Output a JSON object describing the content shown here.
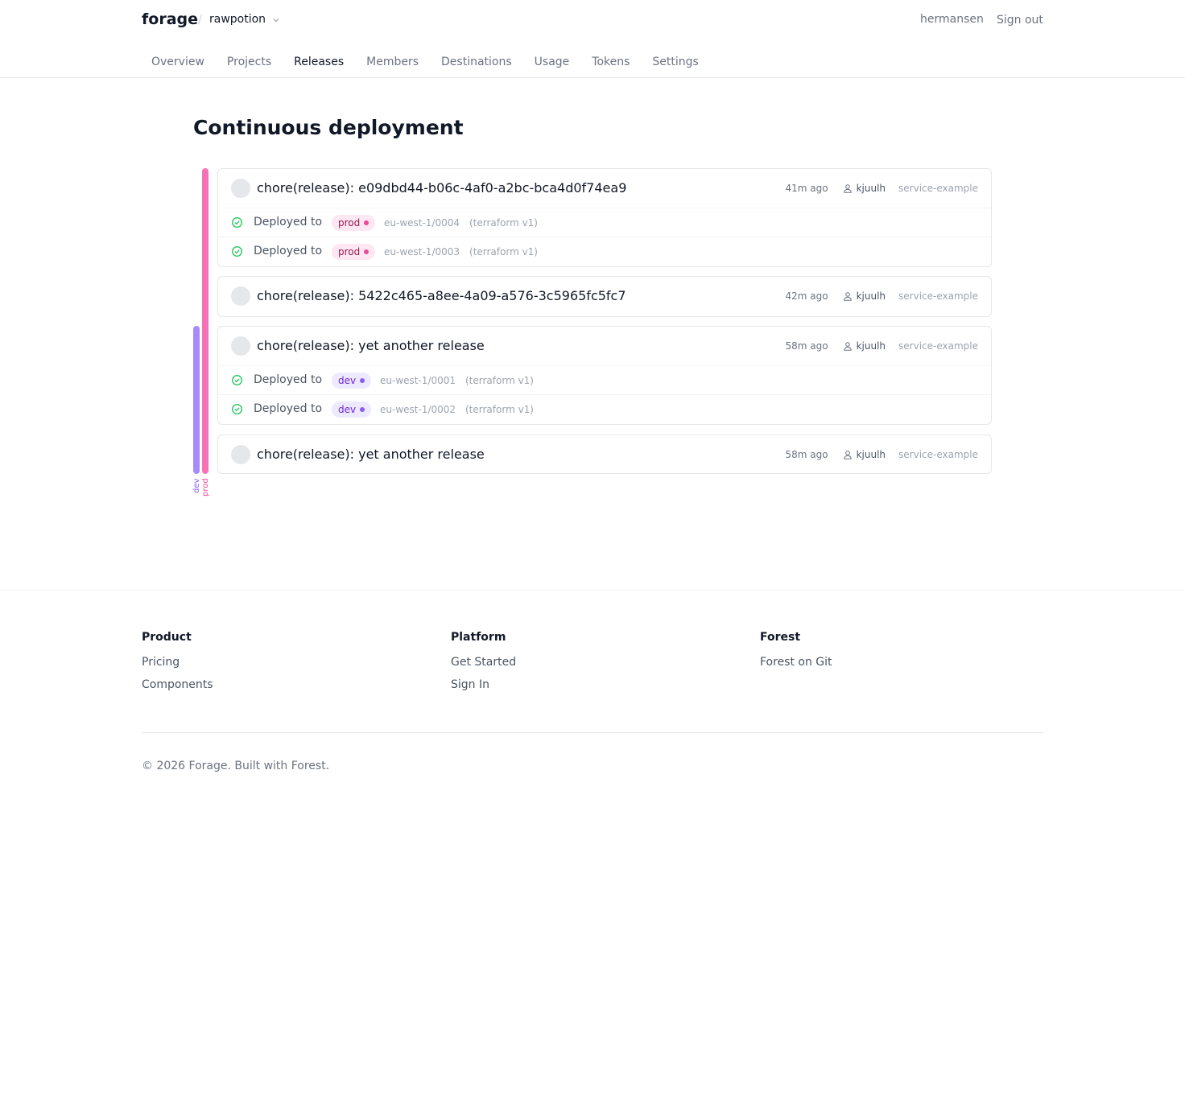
{
  "header": {
    "brand": "forage",
    "separator": "/",
    "organisation": "rawpotion",
    "username": "hermansen",
    "sign_out": "Sign out",
    "tabs": [
      {
        "label": "Overview",
        "active": false
      },
      {
        "label": "Projects",
        "active": false
      },
      {
        "label": "Releases",
        "active": true
      },
      {
        "label": "Members",
        "active": false
      },
      {
        "label": "Destinations",
        "active": false
      },
      {
        "label": "Usage",
        "active": false
      },
      {
        "label": "Tokens",
        "active": false
      },
      {
        "label": "Settings",
        "active": false
      }
    ]
  },
  "main": {
    "title": "Continuous deployment",
    "lanes": [
      {
        "name": "dev",
        "color": "#a78bfa"
      },
      {
        "name": "prod",
        "color": "#f472b6"
      }
    ],
    "releases": [
      {
        "title": "chore(release): e09dbd44-b06c-4af0-a2bc-bca4d0f74ea9",
        "time": "41m ago",
        "author": "kjuulh",
        "service": "service-example",
        "deployments": [
          {
            "label": "Deployed to",
            "env": "prod",
            "destination": "eu-west-1/0004",
            "kind": "(terraform v1)"
          },
          {
            "label": "Deployed to",
            "env": "prod",
            "destination": "eu-west-1/0003",
            "kind": "(terraform v1)"
          }
        ]
      },
      {
        "title": "chore(release): 5422c465-a8ee-4a09-a576-3c5965fc5fc7",
        "time": "42m ago",
        "author": "kjuulh",
        "service": "service-example",
        "deployments": []
      },
      {
        "title": "chore(release): yet another release",
        "time": "58m ago",
        "author": "kjuulh",
        "service": "service-example",
        "deployments": [
          {
            "label": "Deployed to",
            "env": "dev",
            "destination": "eu-west-1/0001",
            "kind": "(terraform v1)"
          },
          {
            "label": "Deployed to",
            "env": "dev",
            "destination": "eu-west-1/0002",
            "kind": "(terraform v1)"
          }
        ]
      },
      {
        "title": "chore(release): yet another release",
        "time": "58m ago",
        "author": "kjuulh",
        "service": "service-example",
        "deployments": []
      }
    ]
  },
  "footer": {
    "columns": [
      {
        "heading": "Product",
        "links": [
          "Pricing",
          "Components"
        ]
      },
      {
        "heading": "Platform",
        "links": [
          "Get Started",
          "Sign In"
        ]
      },
      {
        "heading": "Forest",
        "links": [
          "Forest on Git"
        ]
      }
    ],
    "copyright": "© 2026 Forage. Built with Forest."
  },
  "colors": {
    "prod": "#ec4899",
    "dev": "#8b5cf6",
    "success": "#22c55e"
  }
}
